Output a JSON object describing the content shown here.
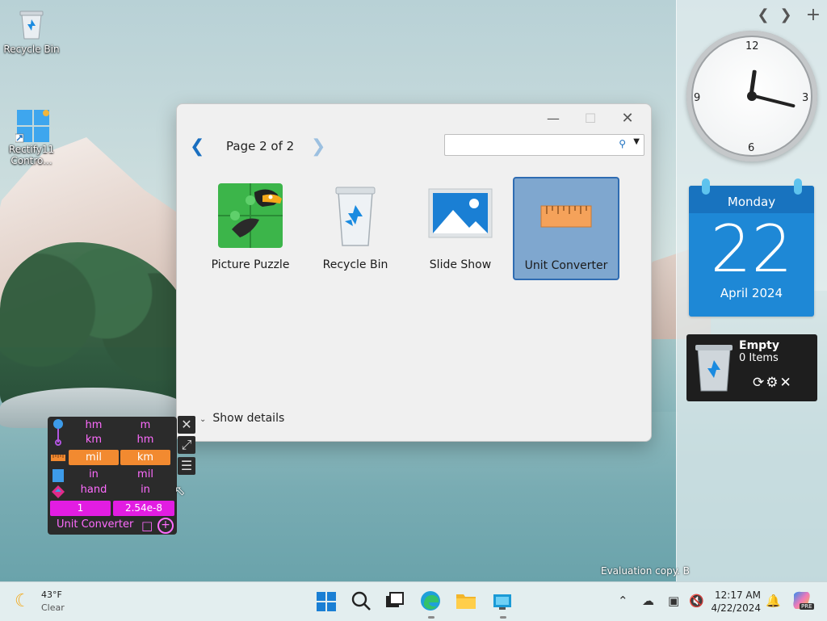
{
  "desktop": {
    "icons": [
      {
        "label": "Recycle Bin"
      },
      {
        "label": "Rectify11\nContro..."
      }
    ],
    "watermark": "Evaluation copy. B"
  },
  "dialog": {
    "page_label": "Page 2 of 2",
    "search_value": "",
    "gadgets": [
      {
        "label": "Picture Puzzle"
      },
      {
        "label": "Recycle Bin"
      },
      {
        "label": "Slide Show"
      },
      {
        "label": "Unit Converter",
        "selected": true
      }
    ],
    "show_details_label": "Show details"
  },
  "unit_converter": {
    "rows": [
      {
        "left": "hm",
        "right": "m"
      },
      {
        "left": "km",
        "right": "hm"
      },
      {
        "left": "mil",
        "right": "km"
      },
      {
        "left": "in",
        "right": "mil"
      },
      {
        "left": "hand",
        "right": "in"
      }
    ],
    "input_value": "1",
    "output_value": "2.54e-8",
    "title": "Unit Converter"
  },
  "sidebar": {
    "clock": {
      "numbers": [
        "12",
        "3",
        "6",
        "9"
      ],
      "hour": 12,
      "minute": 17
    },
    "calendar": {
      "weekday": "Monday",
      "day": "22",
      "month_year": "April 2024"
    },
    "recycle_bin": {
      "status": "Empty",
      "items": "0 Items"
    }
  },
  "taskbar": {
    "weather": {
      "temp": "43°F",
      "condition": "Clear"
    },
    "time": "12:17 AM",
    "date": "4/22/2024",
    "copilot_badge": "PRE"
  },
  "colors": {
    "accent": "#1a6fc0",
    "selection": "#7fa7cf",
    "calendar_blue": "#1e88d6",
    "uc_magenta": "#e21de2",
    "uc_orange": "#f28a30"
  }
}
